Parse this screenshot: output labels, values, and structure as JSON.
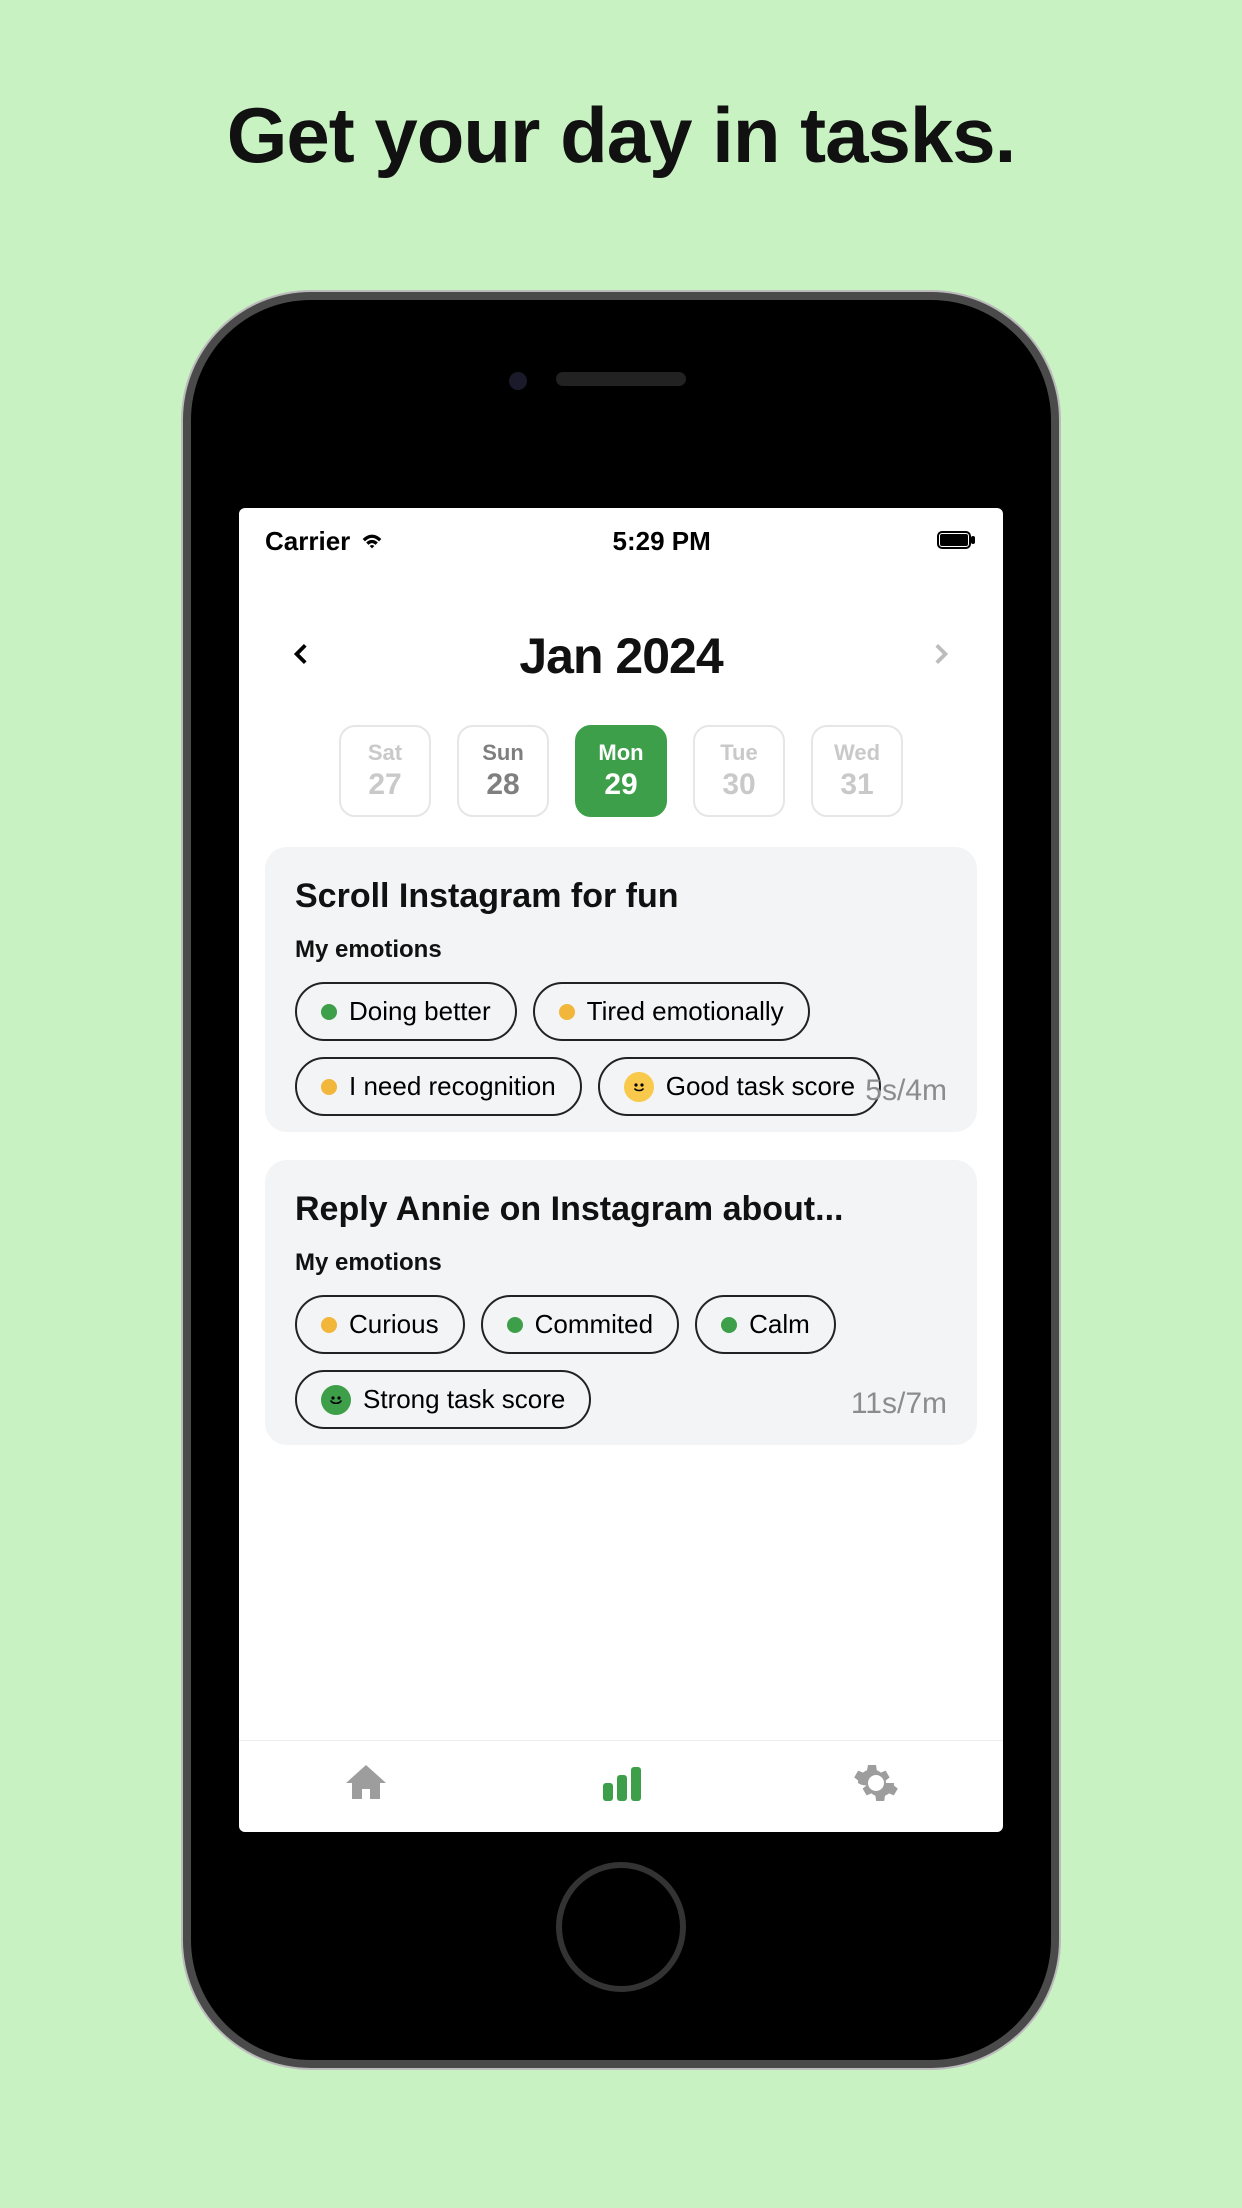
{
  "headline": "Get your day in tasks.",
  "status": {
    "carrier": "Carrier",
    "time": "5:29 PM"
  },
  "month": {
    "label": "Jan 2024"
  },
  "days": [
    {
      "dow": "Sat",
      "dnum": "27",
      "state": "dim"
    },
    {
      "dow": "Sun",
      "dnum": "28",
      "state": "near"
    },
    {
      "dow": "Mon",
      "dnum": "29",
      "state": "active"
    },
    {
      "dow": "Tue",
      "dnum": "30",
      "state": "dim"
    },
    {
      "dow": "Wed",
      "dnum": "31",
      "state": "dim"
    }
  ],
  "cards": [
    {
      "title": "Scroll Instagram for fun",
      "subtitle": "My emotions",
      "chips": [
        {
          "dot": "green",
          "label": "Doing better"
        },
        {
          "dot": "yellow",
          "label": "Tired emotionally"
        },
        {
          "dot": "yellow",
          "label": "I need recognition"
        }
      ],
      "score": {
        "face": "yellow",
        "label": "Good task score"
      },
      "time": "5s/4m"
    },
    {
      "title": "Reply Annie on Instagram about...",
      "subtitle": "My emotions",
      "chips": [
        {
          "dot": "yellow",
          "label": "Curious"
        },
        {
          "dot": "green",
          "label": "Commited"
        },
        {
          "dot": "green",
          "label": "Calm"
        }
      ],
      "score": {
        "face": "green",
        "label": "Strong task score"
      },
      "time": "11s/7m"
    }
  ],
  "tabs": {
    "active": "stats"
  }
}
